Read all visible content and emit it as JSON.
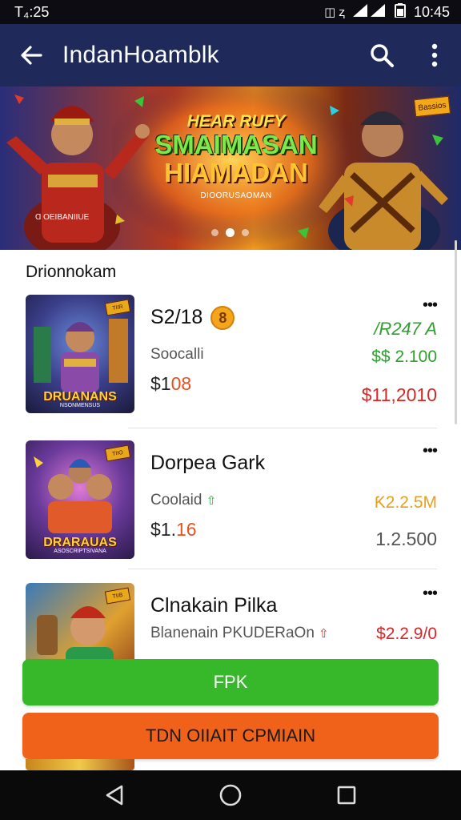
{
  "status_bar": {
    "left_time": "T₄:25",
    "right_time": "10:45",
    "icons": [
      "network-indicator-icon",
      "signal-icon",
      "battery-icon"
    ],
    "left_indicators": "◫ ⱬ"
  },
  "app_bar": {
    "title": "IndanHoamblk",
    "back_icon": "back-arrow-icon",
    "search_icon": "search-icon",
    "menu_icon": "more-vert-icon"
  },
  "banner": {
    "pre_title": "HEAR RUFY",
    "main_title_1": "SMAIMASAN",
    "main_title_2": "HIAMADAN",
    "subtitle": "DIOORUSAOMAN",
    "left_caption": "Ɑ OEIBANIIUE",
    "right_badge": "Bassios",
    "slides": 3,
    "active_slide": 2
  },
  "section": {
    "title": "Drionnokam"
  },
  "games": [
    {
      "name": "S2/18",
      "coin_label": "8",
      "subtitle": "Soocalli",
      "price_prefix": "$1",
      "price_highlight": "08",
      "value_1": "/R247 A",
      "value_2": "$$ 2.100",
      "value_3": "$11,2010",
      "thumb_caption": "DRUANANS",
      "thumb_sub": "NSONMENSUS",
      "thumb_flag": "TIIR",
      "colors": {
        "value_1": "#2f9e2f",
        "value_2": "#2f9e2f",
        "value_3": "#d42828"
      }
    },
    {
      "name": "Dorpea Gark",
      "subtitle": "Coolaid",
      "subtitle_arrow": "⇧",
      "price_prefix": "$1.",
      "price_highlight": "16",
      "value_1": "",
      "value_2": "Ƙ2.2.5M",
      "value_3": "1.2.500",
      "thumb_caption": "DRARAUAS",
      "thumb_sub": "ASOSCRIPTSIVANA",
      "thumb_flag": "TIIO",
      "colors": {
        "value_1": "#2f9e2f",
        "value_2": "#e6a020",
        "value_3": "#555555"
      }
    },
    {
      "name": "Clnakain Pilka",
      "subtitle": "Blanenain PKUDERaOn",
      "subtitle_arrow": "⇧",
      "price_prefix": "",
      "price_highlight": "",
      "value_1": "",
      "value_2": "$2.2.9/0",
      "value_3": "",
      "thumb_caption": "",
      "thumb_sub": "",
      "thumb_flag": "TIIB",
      "colors": {
        "value_1": "#2f9e2f",
        "value_2": "#d42828",
        "value_3": "#555555"
      }
    }
  ],
  "buttons": {
    "primary": "FPK",
    "secondary": "TDN OIIAIT CPMIAIN"
  },
  "nav_bar": {
    "back": "nav-back-icon",
    "home": "nav-home-icon",
    "recents": "nav-recents-icon"
  }
}
